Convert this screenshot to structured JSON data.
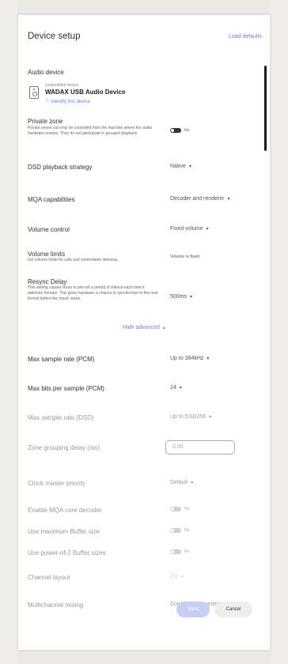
{
  "header": {
    "title": "Device setup",
    "load_defaults": "Load defaults"
  },
  "audio_device": {
    "label": "Audio device",
    "status": "Unidentified device",
    "name": "WADAX USB Audio Device",
    "identify": "Identify this device"
  },
  "private_zone": {
    "label": "Private zone",
    "description": "Private zones can only be controlled from the machine where the audio hardware resides. They do not participate in grouped playback.",
    "toggle_text": "No"
  },
  "dsd_strategy": {
    "label": "DSD playback strategy",
    "value": "Native"
  },
  "mqa": {
    "label": "MQA capabilities",
    "value": "Decoder and renderer"
  },
  "volume_control": {
    "label": "Volume control",
    "value": "Fixed volume"
  },
  "volume_limits": {
    "label": "Volume limits",
    "description": "Set volume limits for safe and comfortable listening.",
    "value": "Volume is fixed"
  },
  "resync_delay": {
    "label": "Resync Delay",
    "description": "This setting causes Roon to pre-roll a period of silence each time it switches formats. This gives hardware a chance to synchronize to the new format before the music starts.",
    "value": "500ms"
  },
  "hide_advanced": "Hide advanced",
  "max_sample_pcm": {
    "label": "Max sample rate (PCM)",
    "value": "Up to 384kHz"
  },
  "max_bits_pcm": {
    "label": "Max bits per sample (PCM)",
    "value": "24"
  },
  "max_sample_dsd": {
    "label": "Max sample rate (DSD)",
    "value": "Up to DSD256"
  },
  "zone_grouping": {
    "label": "Zone grouping delay (ms)",
    "placeholder": "0.00"
  },
  "clock_master": {
    "label": "Clock master priority",
    "value": "Default"
  },
  "enable_mqa_core": {
    "label": "Enable MQA core decoder",
    "toggle_text": "No"
  },
  "max_buffer": {
    "label": "Use maximum Buffer size",
    "toggle_text": "No"
  },
  "pow2_buffer": {
    "label": "Use power-of-2 Buffer sizes",
    "toggle_text": "No"
  },
  "channel_layout": {
    "label": "Channel layout",
    "value": "2.0"
  },
  "multichannel_mixing": {
    "label": "Multichannel mixing",
    "value": "Downmix as needed"
  },
  "footer": {
    "save": "Save",
    "cancel": "Cancel"
  },
  "colors": {
    "accent": "#6b7ee8",
    "save_bg": "#c7cff5"
  }
}
